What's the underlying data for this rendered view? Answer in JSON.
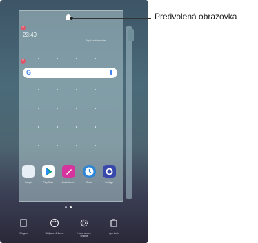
{
  "annotation": {
    "label": "Predvolená obrazovka"
  },
  "weather": {
    "time": "23:49",
    "date": "",
    "tap_hint": "Tap to add weather"
  },
  "search": {
    "logo": "G"
  },
  "apps": [
    {
      "label": "Google",
      "color": "#e8eef5"
    },
    {
      "label": "Play Store",
      "color": "#ffffff"
    },
    {
      "label": "QuickMemo+",
      "color": "#d6339f"
    },
    {
      "label": "Clock",
      "color": "#2f86d6"
    },
    {
      "label": "Settings",
      "color": "#3949ab"
    }
  ],
  "toolbar": {
    "widgets": "Widgets",
    "wallpaper": "Wallpaper & theme",
    "home_settings": "Home screen settings",
    "app_trash": "App trash"
  }
}
